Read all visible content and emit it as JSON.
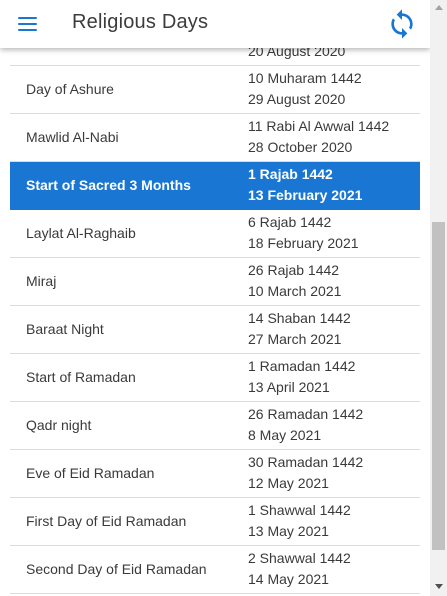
{
  "appbar": {
    "title": "Religious Days",
    "menu_icon": "hamburger-menu-icon",
    "refresh_icon": "refresh-icon",
    "accent_color": "#1976d2"
  },
  "list": {
    "selected_color": "#1976d2",
    "rows": [
      {
        "name": "",
        "hijri": "",
        "gregorian": "20 August 2020"
      },
      {
        "name": "Day of Ashure",
        "hijri": "10 Muharam 1442",
        "gregorian": "29 August 2020"
      },
      {
        "name": "Mawlid Al-Nabi",
        "hijri": "11 Rabi Al Awwal 1442",
        "gregorian": "28 October 2020"
      },
      {
        "name": "Start of Sacred 3 Months",
        "hijri": "1 Rajab 1442",
        "gregorian": "13 February 2021"
      },
      {
        "name": "Laylat Al-Raghaib",
        "hijri": "6 Rajab 1442",
        "gregorian": "18 February 2021"
      },
      {
        "name": "Miraj",
        "hijri": "26 Rajab 1442",
        "gregorian": "10 March 2021"
      },
      {
        "name": "Baraat Night",
        "hijri": "14 Shaban 1442",
        "gregorian": "27 March 2021"
      },
      {
        "name": "Start of Ramadan",
        "hijri": "1 Ramadan 1442",
        "gregorian": "13 April 2021"
      },
      {
        "name": "Qadr night",
        "hijri": "26 Ramadan 1442",
        "gregorian": "8 May 2021"
      },
      {
        "name": "Eve of Eid Ramadan",
        "hijri": "30 Ramadan 1442",
        "gregorian": "12 May 2021"
      },
      {
        "name": "First Day of Eid Ramadan",
        "hijri": "1 Shawwal 1442",
        "gregorian": "13 May 2021"
      },
      {
        "name": "Second Day of Eid Ramadan",
        "hijri": "2 Shawwal 1442",
        "gregorian": "14 May 2021"
      }
    ]
  }
}
